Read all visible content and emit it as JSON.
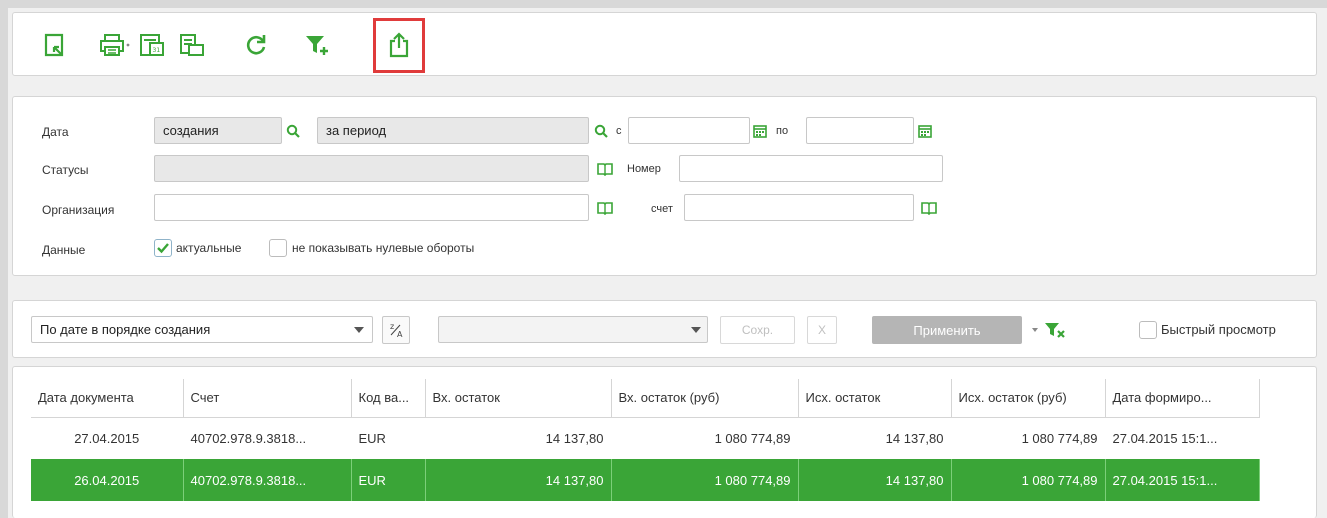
{
  "filters": {
    "date_label": "Дата",
    "date_type_value": "создания",
    "period_value": "за период",
    "from_label": "с",
    "to_label": "по",
    "from_value": "",
    "to_value": "",
    "statuses_label": "Статусы",
    "statuses_value": "",
    "number_label": "Номер",
    "number_value": "",
    "org_label": "Организация",
    "org_value": "",
    "account_label": "счет",
    "account_value": "",
    "data_label": "Данные",
    "actual_label": "актуальные",
    "actual_checked": true,
    "zero_label": "не показывать нулевые обороты",
    "zero_checked": false
  },
  "sortbar": {
    "sort_value": "По дате в порядке создания",
    "sort_dir_label": "Z/A",
    "preset_value": "",
    "save_label": "Сохр.",
    "clear_label": "X",
    "apply_label": "Применить",
    "quick_view_label": "Быстрый просмотр"
  },
  "grid": {
    "columns": [
      "Дата документа",
      "Счет",
      "Код ва...",
      "Вх. остаток",
      "Вх. остаток (руб)",
      "Исх. остаток",
      "Исх. остаток (руб)",
      "Дата формиро..."
    ],
    "rows": [
      [
        "27.04.2015",
        "40702.978.9.3818...",
        "EUR",
        "14 137,80",
        "1 080 774,89",
        "14 137,80",
        "1 080 774,89",
        "27.04.2015 15:1..."
      ],
      [
        "26.04.2015",
        "40702.978.9.3818...",
        "EUR",
        "14 137,80",
        "1 080 774,89",
        "14 137,80",
        "1 080 774,89",
        "27.04.2015 15:1..."
      ]
    ]
  },
  "colors": {
    "accent_green": "#3aa537",
    "highlight_red": "#e03b3b"
  },
  "icons": [
    "new-document-icon",
    "print-icon",
    "calendar-report-icon",
    "print-list-icon",
    "refresh-icon",
    "add-filter-icon",
    "export-icon"
  ]
}
